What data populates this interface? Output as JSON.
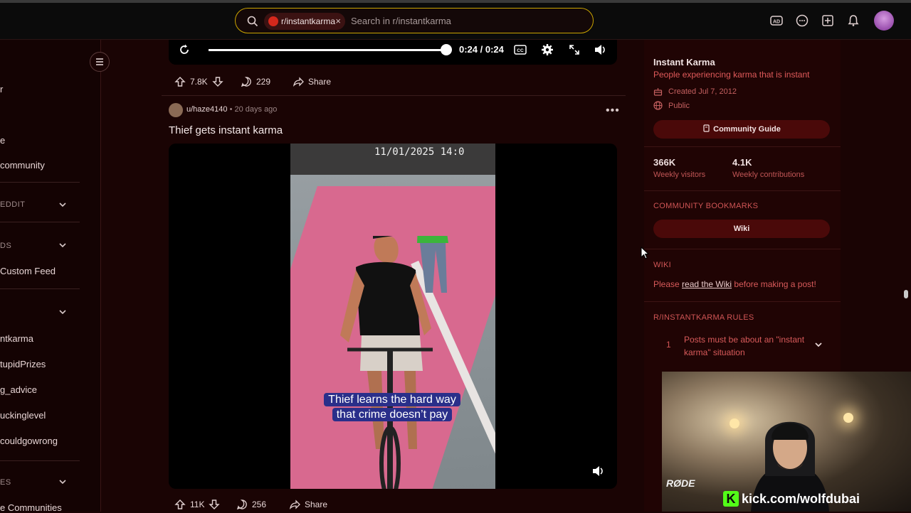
{
  "header": {
    "search_chip": "r/instantkarma",
    "search_chip_close": "×",
    "search_placeholder": "Search in r/instantkarma",
    "icons": [
      "advertise-icon",
      "chat-icon",
      "create-post-icon",
      "notifications-icon"
    ]
  },
  "sidebar": {
    "items": [
      {
        "label": "r",
        "kind": "item"
      },
      {
        "label": "e",
        "kind": "item"
      },
      {
        "label": "community",
        "kind": "item"
      },
      {
        "label": "EDDIT",
        "kind": "section"
      },
      {
        "label": "DS",
        "kind": "section"
      },
      {
        "label": "Custom Feed",
        "kind": "item"
      },
      {
        "label": "ntkarma",
        "kind": "item"
      },
      {
        "label": "tupidPrizes",
        "kind": "item"
      },
      {
        "label": "g_advice",
        "kind": "item"
      },
      {
        "label": "uckinglevel",
        "kind": "item"
      },
      {
        "label": "couldgowrong",
        "kind": "item"
      },
      {
        "label": "ES",
        "kind": "section"
      },
      {
        "label": "e Communities",
        "kind": "item"
      }
    ]
  },
  "previous_post": {
    "time": "0:24 / 0:24",
    "progress": 1.0,
    "upvotes": "7.8K",
    "comments": "229",
    "share": "Share"
  },
  "post": {
    "author": "u/haze4140",
    "age": "20 days ago",
    "separator": "•",
    "title": "Thief gets instant karma",
    "video_timestamp": "11/01/2025 14:0",
    "caption_line1": "Thief learns the hard way",
    "caption_line2": "that crime doesn’t pay",
    "upvotes": "11K",
    "comments": "256",
    "share": "Share"
  },
  "community": {
    "name": "Instant Karma",
    "description": "People experiencing karma that is instant",
    "created": "Created Jul 7, 2012",
    "visibility": "Public",
    "guide_button": "Community Guide",
    "weekly_visitors": "366K",
    "weekly_visitors_label": "Weekly visitors",
    "weekly_contrib": "4.1K",
    "weekly_contrib_label": "Weekly contributions",
    "bookmarks_heading": "COMMUNITY BOOKMARKS",
    "wiki_button": "Wiki",
    "wiki_heading": "WIKI",
    "wiki_text_before": "Please ",
    "wiki_link": "read the Wiki",
    "wiki_text_after": " before making a post!",
    "rules_heading": "R/INSTANTKARMA RULES",
    "rule_1_num": "1",
    "rule_1_text": "Posts must be about an \"instant karma\" situation"
  },
  "webcam": {
    "mic_brand": "RØDE",
    "kick_logo": "K",
    "kick_url": "kick.com/wolfdubai"
  },
  "colors": {
    "accent_red": "#d85a5a",
    "background": "#1a0404",
    "search_border": "#c9a400",
    "kick_green": "#53fc18"
  }
}
